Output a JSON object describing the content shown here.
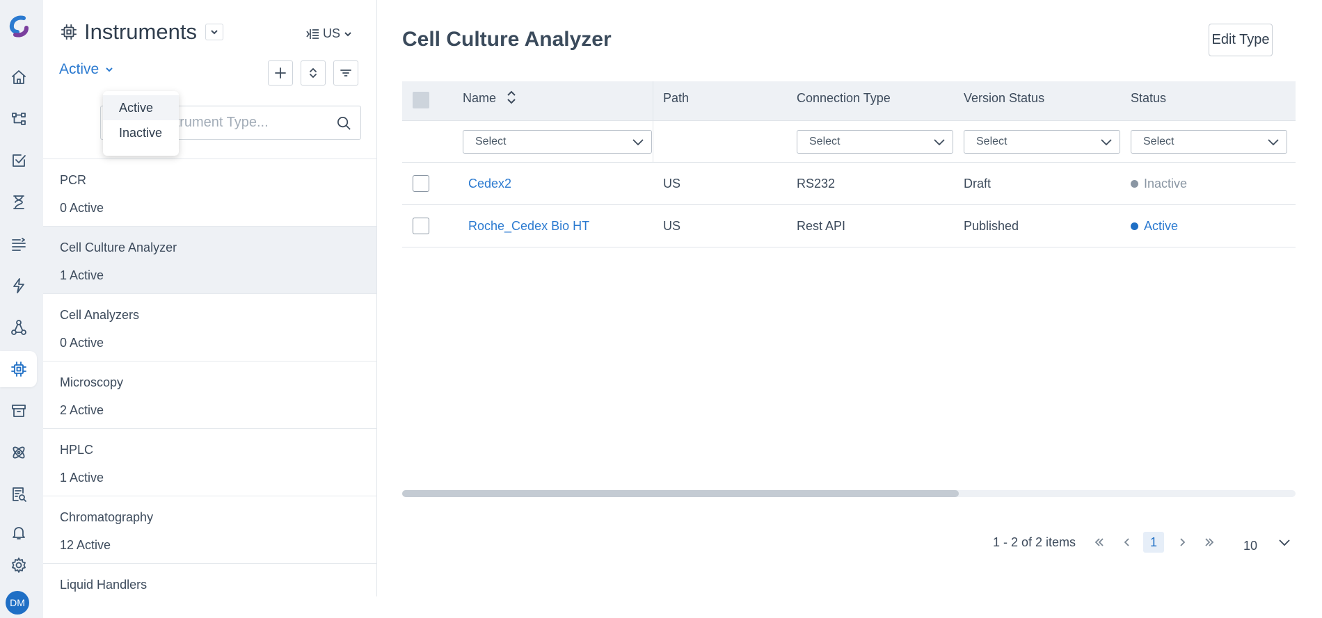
{
  "rail": {
    "items": [
      {
        "name": "home",
        "icon": "home-icon"
      },
      {
        "name": "workflows",
        "icon": "workflow-icon"
      },
      {
        "name": "tasks",
        "icon": "checkbox-icon"
      },
      {
        "name": "processes",
        "icon": "hourglass-icon"
      },
      {
        "name": "lists",
        "icon": "list-icon"
      },
      {
        "name": "actions",
        "icon": "lightning-icon"
      },
      {
        "name": "network",
        "icon": "network-icon"
      },
      {
        "name": "instruments",
        "icon": "chip-icon"
      },
      {
        "name": "archive",
        "icon": "archive-icon"
      },
      {
        "name": "molecules",
        "icon": "atom-icon"
      },
      {
        "name": "reports",
        "icon": "report-search-icon"
      },
      {
        "name": "notifications",
        "icon": "bell-icon"
      },
      {
        "name": "settings",
        "icon": "gear-icon"
      }
    ],
    "active": "instruments",
    "avatar_initials": "DM",
    "accent_color": "#1f6fc5"
  },
  "panel": {
    "title": "Instruments",
    "site": "US",
    "status_filter": "Active",
    "status_options": [
      "Active",
      "Inactive"
    ],
    "search_placeholder": "Search Instrument Type...",
    "types": [
      {
        "name": "PCR",
        "count": "0 Active"
      },
      {
        "name": "Cell Culture Analyzer",
        "count": "1 Active"
      },
      {
        "name": "Cell Analyzers",
        "count": "0 Active"
      },
      {
        "name": "Microscopy",
        "count": "2 Active"
      },
      {
        "name": "HPLC",
        "count": "1 Active"
      },
      {
        "name": "Chromatography",
        "count": "12 Active"
      },
      {
        "name": "Liquid Handlers",
        "count": ""
      }
    ],
    "selected_type": "Cell Culture Analyzer"
  },
  "main": {
    "title": "Cell Culture Analyzer",
    "edit_button": "Edit Type",
    "columns": [
      "Name",
      "Path",
      "Connection Type",
      "Version Status",
      "Status"
    ],
    "filter_placeholder": "Select",
    "rows": [
      {
        "name": "Cedex2",
        "path": "US",
        "connection": "RS232",
        "version": "Draft",
        "status": "Inactive",
        "status_color": "#8a96a3"
      },
      {
        "name": "Roche_Cedex Bio HT",
        "path": "US",
        "connection": "Rest API",
        "version": "Published",
        "status": "Active",
        "status_color": "#1f6fc5"
      }
    ],
    "pager": {
      "info": "1 - 2 of 2 items",
      "current_page": "1",
      "page_size": "10"
    }
  }
}
